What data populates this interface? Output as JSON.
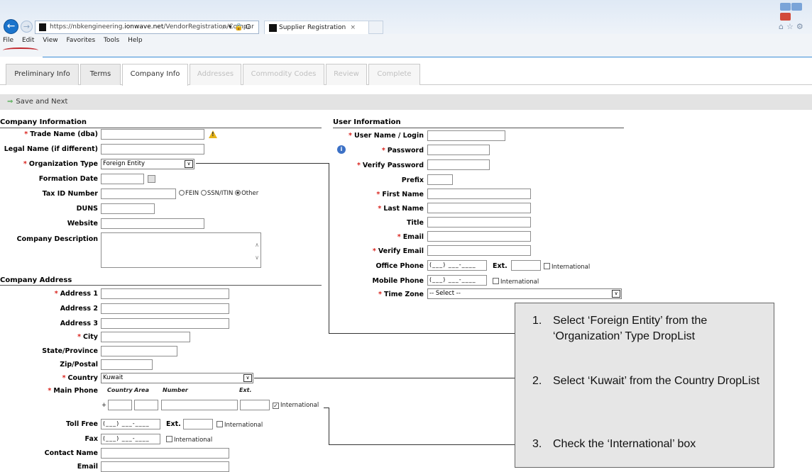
{
  "browser": {
    "url_prefix": "https://nbkengineering.",
    "url_domain": "ionwave.net",
    "url_path": "/VendorRegistration/Compar",
    "addr_icons": "⌕ ▾ 🔒 C",
    "tab_title": "Supplier Registration",
    "tab_close": "×",
    "menu": [
      "File",
      "Edit",
      "View",
      "Favorites",
      "Tools",
      "Help"
    ]
  },
  "tabs": [
    {
      "label": "Preliminary Info",
      "state": "normal"
    },
    {
      "label": "Terms",
      "state": "normal"
    },
    {
      "label": "Company Info",
      "state": "active"
    },
    {
      "label": "Addresses",
      "state": "disabled"
    },
    {
      "label": "Commodity Codes",
      "state": "disabled"
    },
    {
      "label": "Review",
      "state": "disabled"
    },
    {
      "label": "Complete",
      "state": "disabled"
    }
  ],
  "toolbar": {
    "save_next": "Save and Next"
  },
  "company_info": {
    "title": "Company Information",
    "trade_name": "Trade Name (dba)",
    "legal_name": "Legal Name (if different)",
    "org_type": "Organization Type",
    "org_type_value": "Foreign Entity",
    "formation_date": "Formation Date",
    "tax_id": "Tax ID Number",
    "tax_opts": [
      "FEIN",
      "SSN/ITIN",
      "Other"
    ],
    "tax_selected": "Other",
    "duns": "DUNS",
    "website": "Website",
    "description": "Company Description"
  },
  "company_address": {
    "title": "Company Address",
    "address1": "Address 1",
    "address2": "Address 2",
    "address3": "Address 3",
    "city": "City",
    "state": "State/Province",
    "zip": "Zip/Postal",
    "country": "Country",
    "country_value": "Kuwait",
    "main_phone": "Main Phone",
    "phone_cols": [
      "Country",
      "Area",
      "Number",
      "Ext."
    ],
    "plus": "+",
    "international": "International",
    "international_checked": true,
    "toll_free": "Toll Free",
    "fax": "Fax",
    "contact_name": "Contact Name",
    "email": "Email",
    "ext": "Ext.",
    "phone_mask": "(___) ___-____"
  },
  "user_info": {
    "title": "User Information",
    "username": "User Name / Login",
    "password": "Password",
    "verify_password": "Verify Password",
    "prefix": "Prefix",
    "first_name": "First Name",
    "last_name": "Last Name",
    "title_field": "Title",
    "email": "Email",
    "verify_email": "Verify Email",
    "office_phone": "Office Phone",
    "mobile_phone": "Mobile Phone",
    "time_zone": "Time Zone",
    "time_zone_value": "-- Select --",
    "ext": "Ext.",
    "international": "International"
  },
  "callout": {
    "items": [
      {
        "num": "1.",
        "text": "Select ‘Foreign Entity’ from the ‘Organization’ Type DropList"
      },
      {
        "num": "2.",
        "text": "Select ‘Kuwait’ from the Country DropList"
      },
      {
        "num": "3.",
        "text": "Check the ‘International’ box"
      }
    ]
  },
  "icons": {
    "warning": "!",
    "info": "i",
    "dropdown": "∨",
    "check": "✓",
    "arrow": "⇒"
  }
}
